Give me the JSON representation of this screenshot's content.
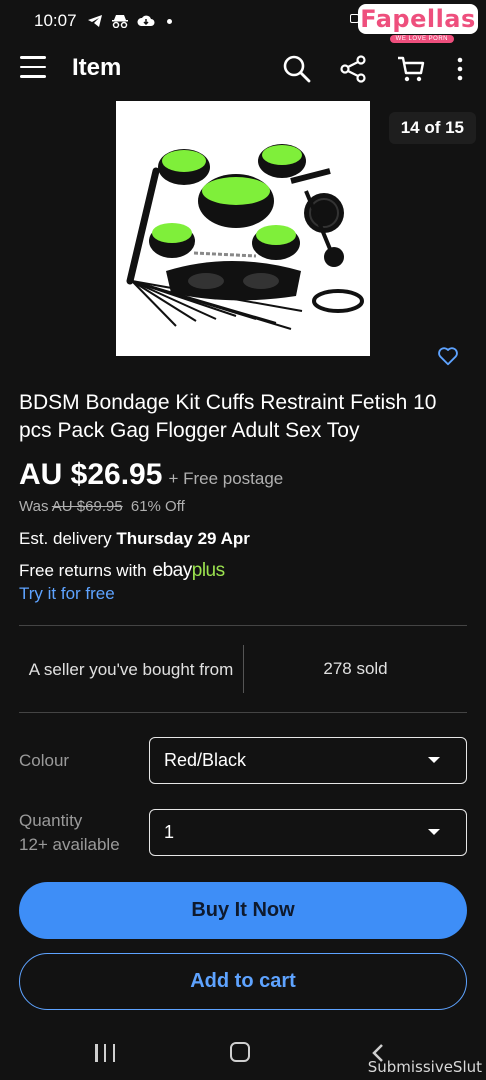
{
  "status_bar": {
    "time": "10:07"
  },
  "watermark": {
    "brand": "Fapellas",
    "tagline": "WE LOVE PORN"
  },
  "app_bar": {
    "title": "Item"
  },
  "gallery": {
    "counter": "14 of 15"
  },
  "item": {
    "title": "BDSM Bondage Kit Cuffs Restraint Fetish 10 pcs Pack Gag Flogger Adult Sex Toy",
    "price": "AU $26.95",
    "postage": "+ Free postage",
    "was_label": "Was",
    "was_price": "AU $69.95",
    "discount": "61% Off",
    "delivery_prefix": "Est. delivery",
    "delivery_date": "Thursday 29 Apr",
    "returns_text": "Free returns with",
    "ebay_part": "ebay",
    "plus_part": "plus",
    "try_link": "Try it for free"
  },
  "seller": {
    "note": "A seller you've bought from",
    "sold": "278 sold"
  },
  "colour": {
    "label": "Colour",
    "value": "Red/Black"
  },
  "quantity": {
    "label": "Quantity",
    "available": "12+ available",
    "value": "1"
  },
  "actions": {
    "buy_now": "Buy It Now",
    "add_to_cart": "Add to cart"
  },
  "credit": "SubmissiveSlut",
  "colors": {
    "accent": "#3e8ef7",
    "link": "#5ea3ff",
    "background": "#121212",
    "product_green": "#7fef3a"
  }
}
